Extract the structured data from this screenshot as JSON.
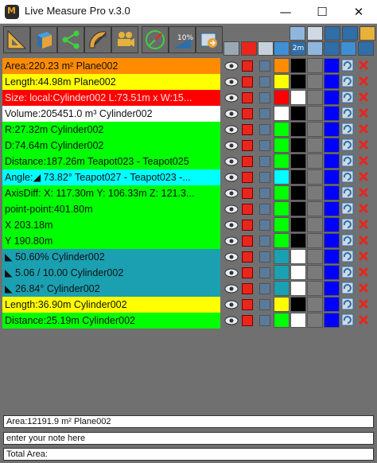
{
  "window": {
    "title": "Live Measure Pro v.3.0",
    "minimize": "—",
    "maximize": "☐",
    "close": "✕"
  },
  "colors": {
    "orange": "#ff8c00",
    "yellow": "#ffff00",
    "red": "#ff0000",
    "white": "#ffffff",
    "green": "#00ff00",
    "cyan": "#00ffff",
    "teal": "#1aa0b0",
    "blue": "#0000ff",
    "black": "#000000"
  },
  "toolbar": {
    "tools": [
      "ruler-triangle-icon",
      "box-measure-icon",
      "share-nodes-icon",
      "protractor-icon",
      "camera-icon",
      "angle-gauge-icon",
      "slope-percent-icon",
      "export-icon"
    ],
    "slope_label": "10%"
  },
  "header_icons": [
    "eye-icon",
    "red-grid-icon",
    "color-pick-icon",
    "cube-icon",
    "square-meter-icon",
    "line-icon",
    "arrow-icon",
    "refresh-all-icon"
  ],
  "header_area_label": "2m",
  "rows": [
    {
      "text": "Area:220.23 m²  Plane002",
      "bg": "orange",
      "c1": "orange",
      "c2": "black",
      "c4": "blue"
    },
    {
      "text": "Length:44.98m  Plane002",
      "bg": "yellow",
      "c1": "yellow",
      "c2": "black",
      "c4": "blue"
    },
    {
      "text": "Size: local:Cylinder002 L:73.51m x W:15...",
      "bg": "red",
      "c1": "red",
      "c2": "white",
      "c4": "blue"
    },
    {
      "text": "Volume:205451.0 m³  Cylinder002",
      "bg": "white",
      "c1": "white",
      "c2": "black",
      "c4": "blue"
    },
    {
      "text": "R:27.32m  Cylinder002",
      "bg": "green",
      "c1": "green",
      "c2": "black",
      "c4": "blue"
    },
    {
      "text": "D:74.64m  Cylinder002",
      "bg": "green",
      "c1": "green",
      "c2": "black",
      "c4": "blue"
    },
    {
      "text": "Distance:187.26m  Teapot023 - Teapot025",
      "bg": "green",
      "c1": "green",
      "c2": "black",
      "c4": "blue"
    },
    {
      "text": "Angle:◢ 73.82°  Teapot027 - Teapot023 -...",
      "bg": "cyan",
      "c1": "cyan",
      "c2": "black",
      "c4": "blue"
    },
    {
      "text": "AxisDiff: X: 117.30m Y: 106.33m Z: 121.3...",
      "bg": "green",
      "c1": "green",
      "c2": "black",
      "c4": "blue"
    },
    {
      "text": "point-point:401.80m",
      "bg": "green",
      "c1": "green",
      "c2": "black",
      "c4": "blue"
    },
    {
      "text": "X 203.18m",
      "bg": "green",
      "c1": "green",
      "c2": "black",
      "c4": "blue"
    },
    {
      "text": "Y 190.80m",
      "bg": "green",
      "c1": "green",
      "c2": "black",
      "c4": "blue"
    },
    {
      "text": "◣ 50.60%  Cylinder002",
      "bg": "teal",
      "c1": "teal",
      "c2": "white",
      "c4": "blue"
    },
    {
      "text": "◣ 5.06 / 10.00  Cylinder002",
      "bg": "teal",
      "c1": "teal",
      "c2": "white",
      "c4": "blue"
    },
    {
      "text": "◣ 26.84°  Cylinder002",
      "bg": "teal",
      "c1": "teal",
      "c2": "white",
      "c4": "blue"
    },
    {
      "text": "Length:36.90m  Cylinder002",
      "bg": "yellow",
      "c1": "yellow",
      "c2": "black",
      "c4": "blue"
    },
    {
      "text": "Distance:25.19m  Cylinder002",
      "bg": "green",
      "c1": "green",
      "c2": "white",
      "c4": "blue"
    }
  ],
  "footer": {
    "area_info": "Area:12191.9 m²  Plane002",
    "note_placeholder": "enter your note here",
    "total_area": "Total Area:"
  }
}
